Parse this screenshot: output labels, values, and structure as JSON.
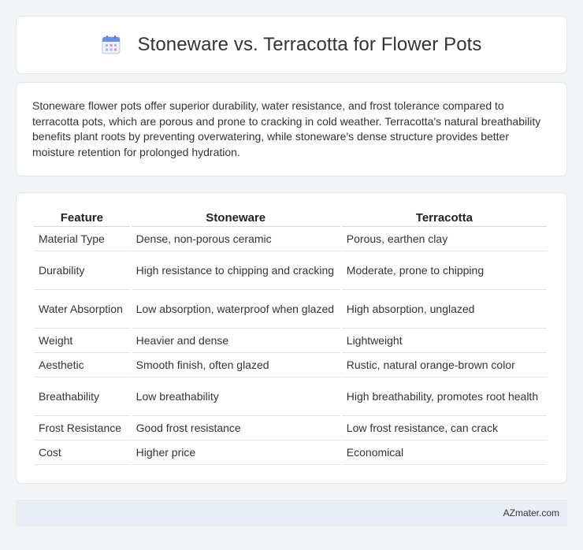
{
  "header": {
    "title": "Stoneware vs. Terracotta for Flower Pots",
    "icon": "calendar-icon"
  },
  "summary": {
    "text": "Stoneware flower pots offer superior durability, water resistance, and frost tolerance compared to terracotta pots, which are porous and prone to cracking in cold weather. Terracotta's natural breathability benefits plant roots by preventing overwatering, while stoneware's dense structure provides better moisture retention for prolonged hydration."
  },
  "table": {
    "headers": [
      "Feature",
      "Stoneware",
      "Terracotta"
    ],
    "rows": [
      {
        "feature": "Material Type",
        "stoneware": "Dense, non-porous ceramic",
        "terracotta": "Porous, earthen clay"
      },
      {
        "feature": "Durability",
        "stoneware": "High resistance to chipping and cracking",
        "terracotta": "Moderate, prone to chipping"
      },
      {
        "feature": "Water Absorption",
        "stoneware": "Low absorption, waterproof when glazed",
        "terracotta": "High absorption, unglazed"
      },
      {
        "feature": "Weight",
        "stoneware": "Heavier and dense",
        "terracotta": "Lightweight"
      },
      {
        "feature": "Aesthetic",
        "stoneware": "Smooth finish, often glazed",
        "terracotta": "Rustic, natural orange-brown color"
      },
      {
        "feature": "Breathability",
        "stoneware": "Low breathability",
        "terracotta": "High breathability, promotes root health"
      },
      {
        "feature": "Frost Resistance",
        "stoneware": "Good frost resistance",
        "terracotta": "Low frost resistance, can crack"
      },
      {
        "feature": "Cost",
        "stoneware": "Higher price",
        "terracotta": "Economical"
      }
    ]
  },
  "footer": {
    "brand": "AZmater.com"
  },
  "colors": {
    "background": "#f3f4f6",
    "card": "#ffffff",
    "footer": "#e8edf6",
    "icon_blue": "#6d8fe0",
    "icon_pink": "#e58fb0"
  }
}
